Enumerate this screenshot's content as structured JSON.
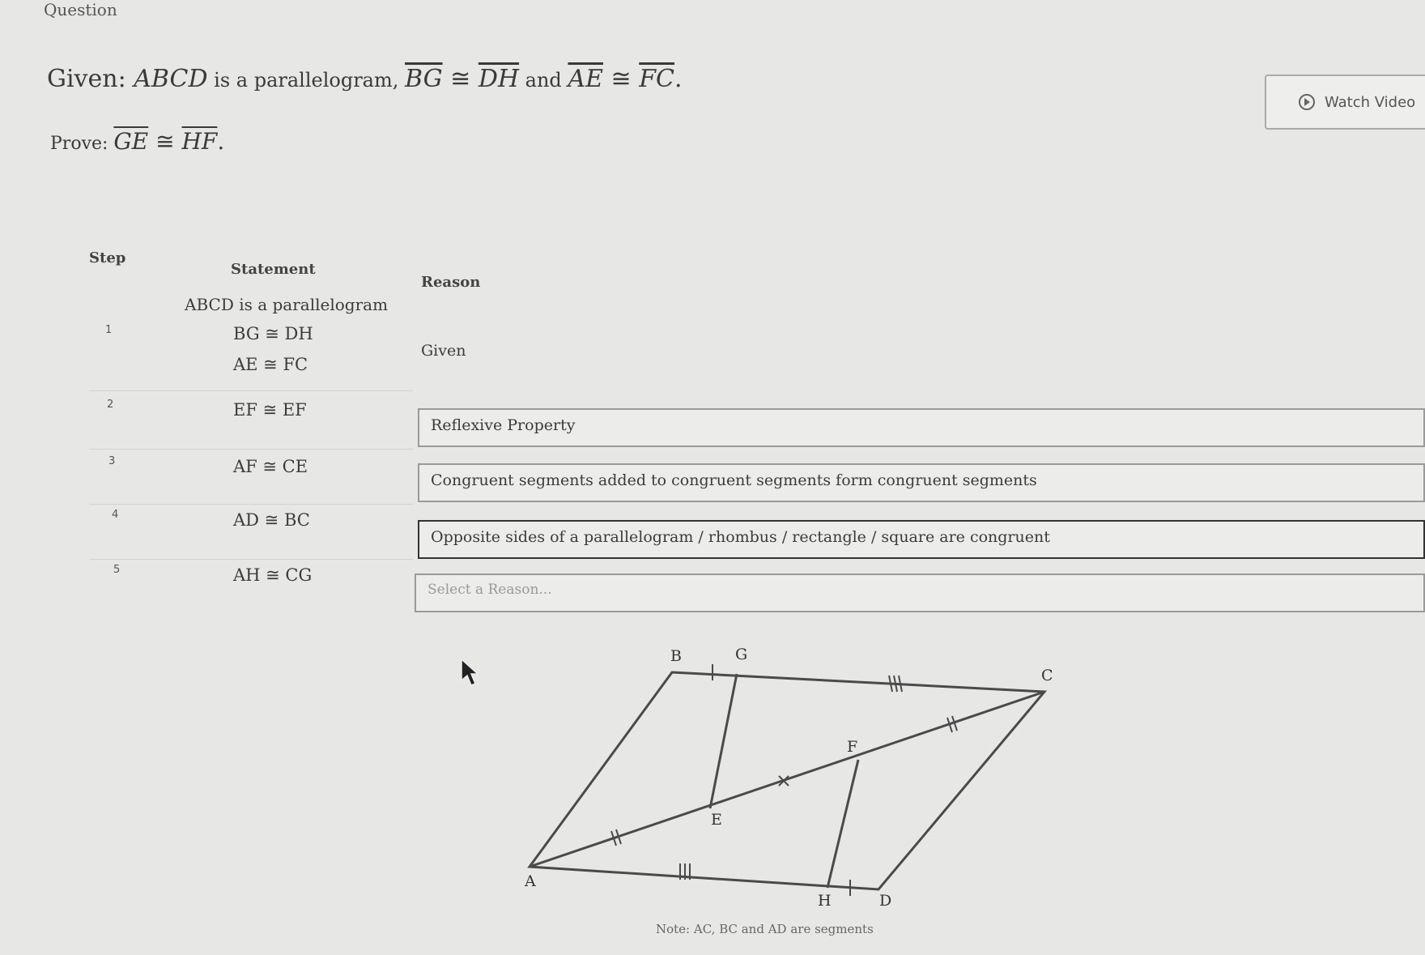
{
  "header": {
    "title": "Question"
  },
  "problem": {
    "given_prefix": "Given: ",
    "given_figure": "ABCD",
    "given_mid": " is a parallelogram, ",
    "given_seg1": "BG",
    "cong": "≅",
    "given_seg2": "DH",
    "given_and": " and ",
    "given_seg3": "AE",
    "given_seg4": "FC",
    "given_end": ".",
    "prove_prefix": "Prove: ",
    "prove_seg1": "GE",
    "prove_seg2": "HF",
    "prove_end": "."
  },
  "watch_video": {
    "label": "Watch Video"
  },
  "table": {
    "headers": {
      "step": "Step",
      "statement": "Statement",
      "reason": "Reason"
    },
    "rows": [
      {
        "step": "1",
        "statements": [
          "ABCD is a parallelogram",
          "BG ≅ DH",
          "AE ≅ FC"
        ],
        "reason": "Given"
      },
      {
        "step": "2",
        "statement": "EF ≅ EF",
        "reason": "Reflexive Property"
      },
      {
        "step": "3",
        "statement": "AF ≅ CE",
        "reason": "Congruent segments added to congruent segments form congruent segments"
      },
      {
        "step": "4",
        "statement": "AD ≅ BC",
        "reason": "Opposite sides of a parallelogram / rhombus / rectangle / square are congruent"
      },
      {
        "step": "5",
        "statement": "AH ≅ CG",
        "reason": "Select a Reason..."
      }
    ]
  },
  "diagram": {
    "labels": {
      "A": "A",
      "B": "B",
      "C": "C",
      "D": "D",
      "E": "E",
      "F": "F",
      "G": "G",
      "H": "H"
    }
  },
  "note": "Note: AC, BC and AD are segments"
}
